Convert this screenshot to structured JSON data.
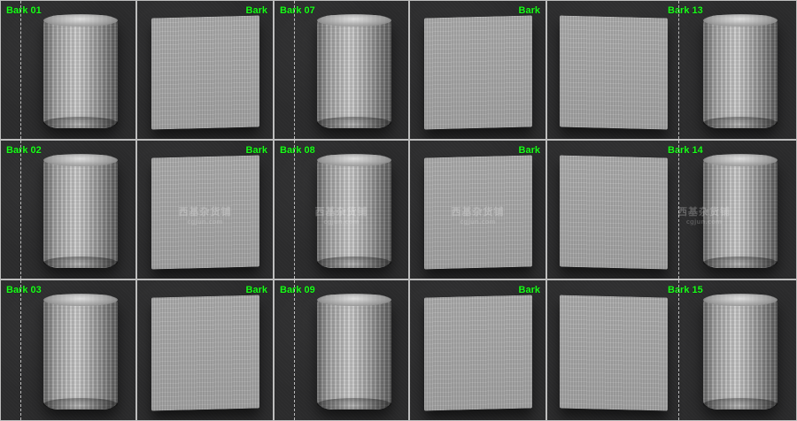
{
  "panels": {
    "r1c1": {
      "label": "Bark 01"
    },
    "r1c2": {
      "label": "Bark"
    },
    "r1c3": {
      "label": "Bark 07"
    },
    "r1c4": {
      "label": "Bark"
    },
    "r1c5": {
      "label": "Bark 13"
    },
    "r2c1": {
      "label": "Bark 02"
    },
    "r2c2": {
      "label": "Bark"
    },
    "r2c3": {
      "label": "Bark 08"
    },
    "r2c4": {
      "label": "Bark"
    },
    "r2c5": {
      "label": "Bark 14"
    },
    "r3c1": {
      "label": "Bark 03"
    },
    "r3c2": {
      "label": "Bark"
    },
    "r3c3": {
      "label": "Bark 09"
    },
    "r3c4": {
      "label": "Bark"
    },
    "r3c5": {
      "label": "Bark 15"
    }
  },
  "watermark": {
    "text": "西基杂货铺",
    "sub": "cgjun.com"
  },
  "colors": {
    "label_green": "#18ff18",
    "divider": "#bdbdbd",
    "background": "#2a2a2b"
  }
}
